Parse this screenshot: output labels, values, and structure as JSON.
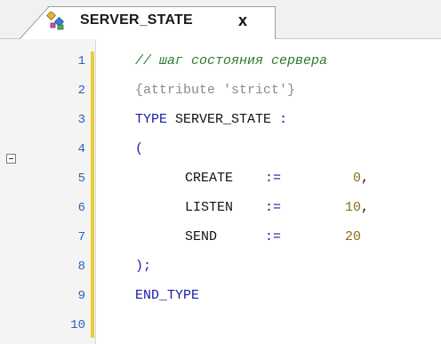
{
  "tab": {
    "title": "SERVER_STATE",
    "close": "x"
  },
  "editor": {
    "line_numbers": [
      "1",
      "2",
      "3",
      "4",
      "5",
      "6",
      "7",
      "8",
      "9",
      "10"
    ],
    "lines": [
      {
        "type": "comment",
        "text": "// шаг состояния сервера"
      },
      {
        "type": "attr",
        "text": "{attribute 'strict'}"
      },
      {
        "type": "decl",
        "kw": "TYPE",
        "name": "SERVER_STATE",
        "colon": ":"
      },
      {
        "type": "paren",
        "text": "("
      },
      {
        "type": "member",
        "name": "CREATE",
        "op": ":=",
        "value": "0",
        "end": ","
      },
      {
        "type": "member",
        "name": "LISTEN",
        "op": ":=",
        "value": "10",
        "end": ","
      },
      {
        "type": "member",
        "name": "SEND",
        "op": ":=",
        "value": "20",
        "end": ""
      },
      {
        "type": "close",
        "text": ");"
      },
      {
        "type": "end",
        "text": "END_TYPE"
      },
      {
        "type": "empty",
        "text": ""
      }
    ]
  },
  "colors": {
    "comment": "#2d7a2d",
    "keyword": "#1a1aa8",
    "attribute": "#8c8c8c",
    "number": "#8a6d1d",
    "line_number": "#2b64b6",
    "change_bar": "#e9cf35"
  }
}
